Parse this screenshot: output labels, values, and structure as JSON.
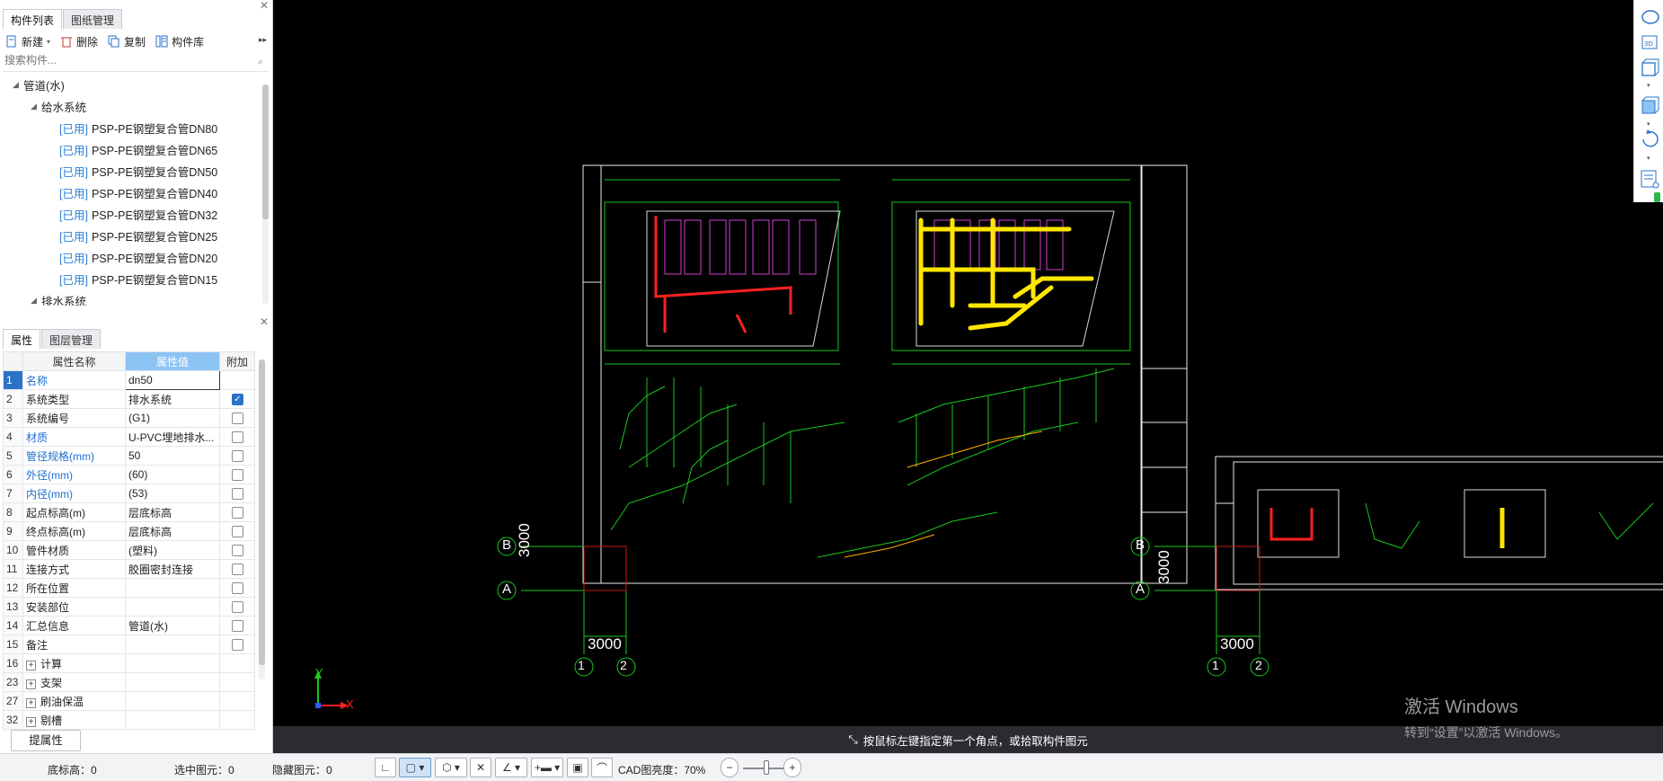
{
  "left_panel": {
    "tabs": [
      "构件列表",
      "图纸管理"
    ],
    "toolbar": {
      "new": "新建",
      "delete": "删除",
      "copy": "复制",
      "library": "构件库"
    },
    "search_placeholder": "搜索构件...",
    "tree": {
      "root": "管道(水)",
      "supply": "给水系统",
      "used_tag": "[已用]",
      "items": [
        "PSP-PE钢塑复合管DN80",
        "PSP-PE钢塑复合管DN65",
        "PSP-PE钢塑复合管DN50",
        "PSP-PE钢塑复合管DN40",
        "PSP-PE钢塑复合管DN32",
        "PSP-PE钢塑复合管DN25",
        "PSP-PE钢塑复合管DN20",
        "PSP-PE钢塑复合管DN15"
      ],
      "drain": "排水系统"
    }
  },
  "props_panel": {
    "tabs": [
      "属性",
      "图层管理"
    ],
    "headers": {
      "name": "属性名称",
      "value": "属性值",
      "extra": "附加"
    },
    "rows": [
      {
        "num": "1",
        "name": "名称",
        "value": "dn50",
        "blue": true,
        "check": "none",
        "edit": true
      },
      {
        "num": "2",
        "name": "系统类型",
        "value": "排水系统",
        "blue": false,
        "check": "on"
      },
      {
        "num": "3",
        "name": "系统编号",
        "value": "(G1)",
        "blue": false,
        "check": "off"
      },
      {
        "num": "4",
        "name": "材质",
        "value": "U-PVC埋地排水...",
        "blue": true,
        "check": "off"
      },
      {
        "num": "5",
        "name": "管径规格(mm)",
        "value": "50",
        "blue": true,
        "check": "off"
      },
      {
        "num": "6",
        "name": "外径(mm)",
        "value": "(60)",
        "blue": true,
        "check": "off"
      },
      {
        "num": "7",
        "name": "内径(mm)",
        "value": "(53)",
        "blue": true,
        "check": "off"
      },
      {
        "num": "8",
        "name": "起点标高(m)",
        "value": "层底标高",
        "blue": false,
        "check": "off"
      },
      {
        "num": "9",
        "name": "终点标高(m)",
        "value": "层底标高",
        "blue": false,
        "check": "off"
      },
      {
        "num": "10",
        "name": "管件材质",
        "value": "(塑料)",
        "blue": false,
        "check": "off"
      },
      {
        "num": "11",
        "name": "连接方式",
        "value": "胶圈密封连接",
        "blue": false,
        "check": "off"
      },
      {
        "num": "12",
        "name": "所在位置",
        "value": "",
        "blue": false,
        "check": "off"
      },
      {
        "num": "13",
        "name": "安装部位",
        "value": "",
        "blue": false,
        "check": "off"
      },
      {
        "num": "14",
        "name": "汇总信息",
        "value": "管道(水)",
        "blue": false,
        "check": "off"
      },
      {
        "num": "15",
        "name": "备注",
        "value": "",
        "blue": false,
        "check": "off"
      },
      {
        "num": "16",
        "name": "计算",
        "value": "",
        "blue": false,
        "check": "none",
        "group": true
      },
      {
        "num": "23",
        "name": "支架",
        "value": "",
        "blue": false,
        "check": "none",
        "group": true
      },
      {
        "num": "27",
        "name": "刷油保温",
        "value": "",
        "blue": false,
        "check": "none",
        "group": true
      },
      {
        "num": "32",
        "name": "剔槽",
        "value": "",
        "blue": false,
        "check": "none",
        "group": true
      }
    ],
    "extract_button": "提属性"
  },
  "canvas": {
    "command_hint": "按鼠标左键指定第一个角点，或拾取构件图元",
    "axis_labels": {
      "b": "B",
      "a": "A",
      "n1": "1",
      "n2": "2",
      "x": "X",
      "y": "Y"
    },
    "dimension": "3000",
    "watermark_line1": "激活 Windows",
    "watermark_line2": "转到“设置”以激活 Windows。"
  },
  "status_bar": {
    "base_elevation": "底标高：0",
    "selected": "选中图元：0",
    "hidden": "隐藏图元：0",
    "cad_brightness": "CAD图亮度：70%"
  },
  "colors": {
    "accent": "#2a73c8",
    "header_value": "#8cc4f4",
    "cad_green": "#19c81e",
    "cad_red": "#ff2020",
    "cad_yellow": "#ffe600",
    "cad_magenta": "#d040d0"
  }
}
